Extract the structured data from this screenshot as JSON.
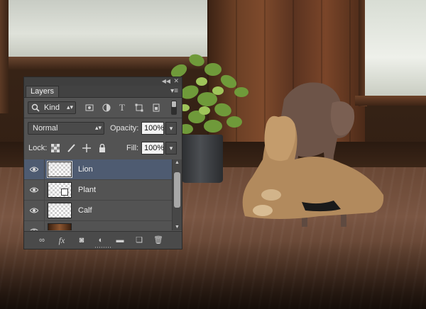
{
  "panel": {
    "title": "Layers",
    "filter": {
      "value": "Kind"
    },
    "blend_mode": "Normal",
    "opacity": {
      "label": "Opacity:",
      "value": "100%"
    },
    "lock": {
      "label": "Lock:"
    },
    "fill": {
      "label": "Fill:",
      "value": "100%"
    },
    "layers": [
      {
        "name": "Lion",
        "visible": true,
        "selected": true
      },
      {
        "name": "Plant",
        "visible": true,
        "selected": false
      },
      {
        "name": "Calf",
        "visible": true,
        "selected": false
      },
      {
        "name": "",
        "visible": true,
        "selected": false
      }
    ],
    "footer_icons": [
      "link-layers-icon",
      "fx-icon",
      "add-mask-icon",
      "adjustment-layer-icon",
      "new-group-icon",
      "new-layer-icon",
      "trash-icon"
    ]
  },
  "colors": {
    "panel_bg": "#535353",
    "selected_row": "#4e5b71"
  }
}
